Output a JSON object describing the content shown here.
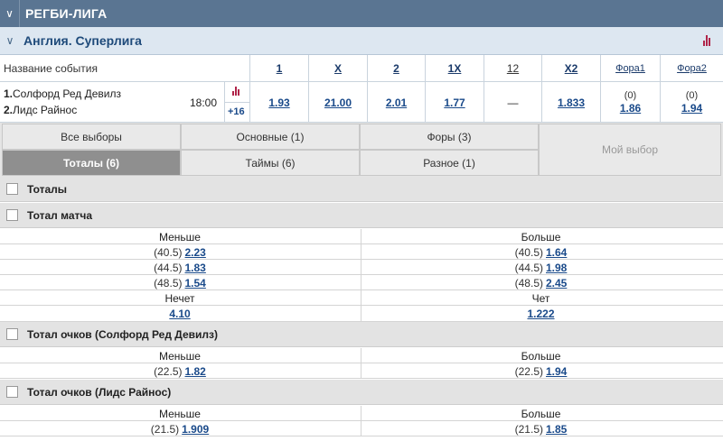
{
  "sport": {
    "title": "РЕГБИ-ЛИГА"
  },
  "league": {
    "title": "Англия. Суперлига"
  },
  "columns": {
    "event_label": "Название события",
    "heads": [
      "1",
      "X",
      "2",
      "1X",
      "12",
      "X2",
      "Фора1",
      "Фора2"
    ]
  },
  "event": {
    "team1_num": "1.",
    "team1": "Солфорд Ред Девилз",
    "team2_num": "2.",
    "team2": "Лидс Райнос",
    "time": "18:00",
    "more": "+16",
    "odds": {
      "c1": "1.93",
      "x": "21.00",
      "c2": "2.01",
      "c1x": "1.77",
      "c12": "—",
      "cx2": "1.833",
      "h1_line": "(0)",
      "h1": "1.86",
      "h2_line": "(0)",
      "h2": "1.94"
    }
  },
  "tabs": {
    "all": "Все выборы",
    "main": "Основные (1)",
    "handicaps": "Форы (3)",
    "mine": "Мой выбор",
    "totals": "Тоталы (6)",
    "halves": "Таймы (6)",
    "misc": "Разное (1)"
  },
  "sections": {
    "totals": "Тоталы",
    "match_total": "Тотал матча",
    "team1_total": "Тотал очков (Солфорд Ред Девилз)",
    "team2_total": "Тотал очков (Лидс Райнос)"
  },
  "labels": {
    "under": "Меньше",
    "over": "Больше",
    "odd": "Нечет",
    "even": "Чет"
  },
  "match_total": [
    {
      "under_line": "(40.5)",
      "under": "2.23",
      "over_line": "(40.5)",
      "over": "1.64"
    },
    {
      "under_line": "(44.5)",
      "under": "1.83",
      "over_line": "(44.5)",
      "over": "1.98"
    },
    {
      "under_line": "(48.5)",
      "under": "1.54",
      "over_line": "(48.5)",
      "over": "2.45"
    }
  ],
  "odd_even": {
    "odd": "4.10",
    "even": "1.222"
  },
  "team1_total": {
    "under_line": "(22.5)",
    "under": "1.82",
    "over_line": "(22.5)",
    "over": "1.94"
  },
  "team2_total": {
    "under_line": "(21.5)",
    "under": "1.909",
    "over_line": "(21.5)",
    "over": "1.85"
  },
  "colors": {
    "sport_bar": "#5a7592",
    "league_bar": "#dde7f1",
    "odd_link": "#1a4a8a",
    "stats_icon": "#b0254a"
  },
  "icons": {
    "collapse": "chevron-down-icon",
    "stats": "bar-chart-icon",
    "checkbox": "checkbox-icon"
  }
}
